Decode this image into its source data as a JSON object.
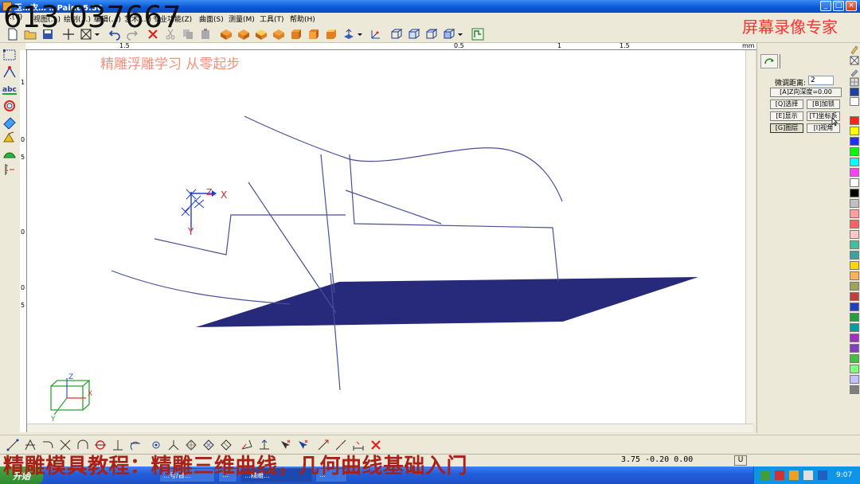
{
  "window": {
    "title": "玉…衣… …Paint 5.50",
    "controls": {
      "minimize": "_",
      "maximize": "□",
      "close": "×"
    }
  },
  "menu": {
    "items": [
      "…(V)",
      "视图(…)",
      "绘制(…)",
      "编辑(…)",
      "艺术(…)",
      "专业功能(Z)",
      "曲面(S)",
      "测量(M)",
      "工具(T)",
      "帮助(H)"
    ]
  },
  "overlay": {
    "phone": "613 037667",
    "recorder_brand": "屏幕录像专家",
    "subtitle": "精雕浮雕学习 从零起步",
    "caption": "精雕模具教程：精雕三维曲线，几何曲线基础入门"
  },
  "ruler": {
    "h_labels": [
      "1.5",
      "0.5",
      "1",
      "1.5"
    ],
    "h_unit": "mm",
    "v_labels": [
      "1",
      "0",
      "5",
      "0",
      "0",
      "5"
    ]
  },
  "canvas": {
    "axis_labels": {
      "x": "X",
      "y": "Y",
      "z": "Z"
    },
    "cube_labels": {
      "x": "X",
      "y": "Y",
      "z": "Z"
    },
    "surface_color": "#272a7a",
    "curve_color": "#4a4f9a"
  },
  "panel": {
    "tab_icon": "rotate-view-icon",
    "distance_label": "微调距离:",
    "distance_value": "2",
    "z_depth": "[A]Z向深度=0.00",
    "buttons": [
      {
        "label": "[Q]选择"
      },
      {
        "label": "[B]加锁"
      },
      {
        "label": "[E]显示"
      },
      {
        "label": "[T]坐标系"
      },
      {
        "label": "[G]图层"
      },
      {
        "label": "[I]视角"
      }
    ]
  },
  "palette": {
    "colors": [
      "#ff2020",
      "#ffff00",
      "#2030ff",
      "#00ff00",
      "#00ffff",
      "#ff40ff",
      "#ffffff",
      "#000000",
      "#c0c0c0",
      "#ffa0a0",
      "#ff6060",
      "#ffc8c8",
      "#40c0a0",
      "#40a0a0",
      "#ffd700",
      "#ffb060",
      "#a0a060",
      "#c04040",
      "#2040c0",
      "#20a040",
      "#00a0a0",
      "#a030c0",
      "#8040c0",
      "#40c040",
      "#80ff80",
      "#c0c0ff",
      "#808080"
    ]
  },
  "status": {
    "coords": "3.75 -0.20 0.00",
    "unit": "U"
  },
  "taskbar": {
    "start": "开始",
    "tasks": [
      "…号/目…",
      "…",
      "…精雕…",
      "…"
    ],
    "clock": "9:07"
  }
}
